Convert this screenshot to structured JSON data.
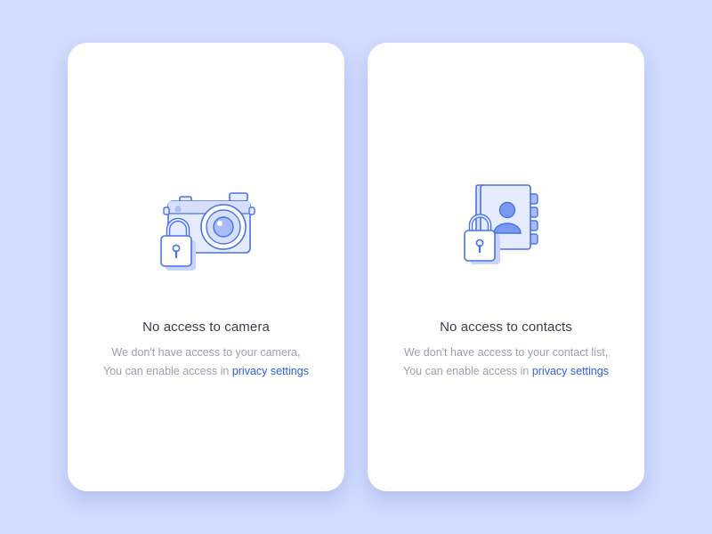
{
  "cards": [
    {
      "title": "No access to camera",
      "line1": "We don't have access to your camera,",
      "line2_prefix": "You can enable access in ",
      "link": "privacy settings",
      "icon": "camera-locked-icon"
    },
    {
      "title": "No access to contacts",
      "line1": "We don't have access to your contact list,",
      "line2_prefix": "You can enable access in ",
      "link": "privacy settings",
      "icon": "contacts-locked-icon"
    }
  ],
  "colors": {
    "background": "#d2dcff",
    "card": "#ffffff",
    "title": "#3b3f4c",
    "text": "#9aa0ad",
    "link": "#2f5fd8",
    "icon_stroke": "#4a72e8",
    "icon_fill": "#e6ecff",
    "icon_accent": "#a9bcf8"
  }
}
